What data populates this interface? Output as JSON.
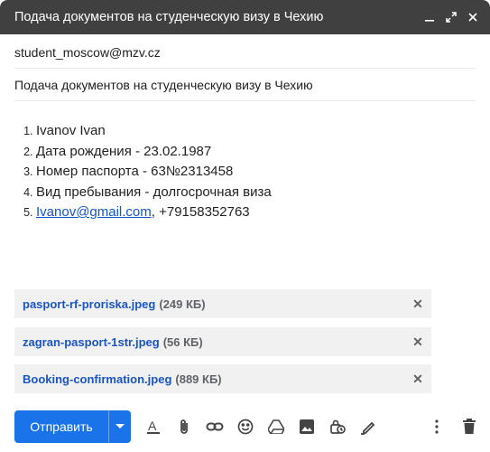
{
  "window": {
    "title": "Подача документов на студенческую визу в Чехию"
  },
  "recipients": {
    "to": "student_moscow@mzv.cz"
  },
  "subject": "Подача документов на студенческую визу в Чехию",
  "body": {
    "items": [
      "Ivanov Ivan",
      "Дата рождения - 23.02.1987",
      "Номер паспорта - 63№2313458",
      "Вид пребывания - долгосрочная виза"
    ],
    "email_link": "Ivanov@gmail.com",
    "phone": ", +79158352763"
  },
  "attachments": [
    {
      "name": "pasport-rf-proriska.jpeg",
      "size": "(249 КБ)"
    },
    {
      "name": "zagran-pasport-1str.jpeg",
      "size": "(56 КБ)"
    },
    {
      "name": "Booking-confirmation.jpeg",
      "size": "(889 КБ)"
    }
  ],
  "toolbar": {
    "send_label": "Отправить",
    "icons": [
      "formatting-icon",
      "attach-icon",
      "link-icon",
      "emoji-icon",
      "drive-icon",
      "photo-icon",
      "confidential-icon",
      "signature-icon",
      "more-options-icon",
      "trash-icon"
    ]
  },
  "colors": {
    "titlebar": "#404040",
    "send": "#1a73e8",
    "link": "#1155cc",
    "attachment_name": "#1a55c4"
  }
}
